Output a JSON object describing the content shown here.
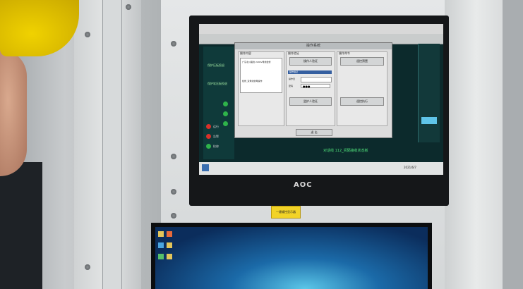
{
  "scene": "cabinet-with-monitors",
  "monitor": {
    "brand": "AOC"
  },
  "screen": {
    "dialog_title": "操作系统",
    "group_left_label": "操作内容",
    "group_mid_label": "操作验证",
    "group_right_label": "操作命令",
    "left_field_text": "广东北川路线 220kV母线检修",
    "left_field_text2": "检修_双母线倒母操作",
    "mid_button_text": "操作人验证",
    "mid_list_header": "操作验证",
    "mid_input_label1": "操作员",
    "mid_input_label2": "密码",
    "mid_password": "●●●",
    "right_button_text": "遥控预置",
    "right_button_text2": "遥控执行",
    "mid_button_text2": "监护人验证",
    "bottom_button": "退 出",
    "bottom_status": "对话线 112_间隔接收状态板",
    "left_panel_items": [
      "保护压板投退",
      "保护软压板投退"
    ],
    "left_led_labels": [
      "运行",
      "告警",
      "检修"
    ],
    "taskbar_time": "2021/6/7"
  },
  "label_plate": {
    "text": "一键顺控显示器"
  },
  "colors": {
    "screen_bg": "#0c2a2c",
    "led_red": "#d8312a",
    "led_green": "#2fb34a",
    "helmet": "#f0d200"
  }
}
